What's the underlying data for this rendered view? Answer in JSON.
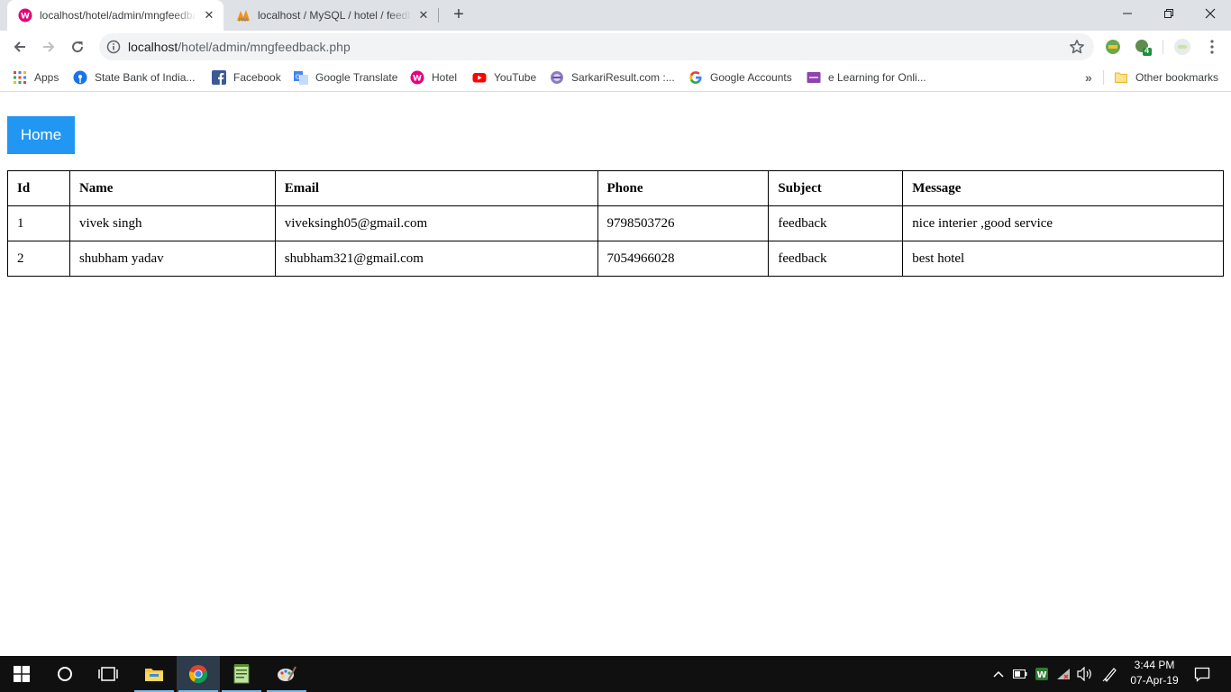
{
  "browser": {
    "tabs": [
      {
        "title": "localhost/hotel/admin/mngfeedback.php",
        "active": true
      },
      {
        "title": "localhost / MySQL / hotel / feedback",
        "active": false
      }
    ],
    "url_host": "localhost",
    "url_path": "/hotel/admin/mngfeedback.php",
    "extension_badge": "4",
    "bookmarks": [
      {
        "label": "Apps",
        "icon": "apps-grid-icon"
      },
      {
        "label": "State Bank of India...",
        "icon": "sbi-icon"
      },
      {
        "label": "Facebook",
        "icon": "facebook-icon"
      },
      {
        "label": "Google Translate",
        "icon": "google-translate-icon"
      },
      {
        "label": "Hotel",
        "icon": "wamp-icon"
      },
      {
        "label": "YouTube",
        "icon": "youtube-icon"
      },
      {
        "label": "SarkariResult.com :...",
        "icon": "sarkari-result-icon"
      },
      {
        "label": "Google Accounts",
        "icon": "google-icon"
      },
      {
        "label": "e Learning for Onli...",
        "icon": "elearning-icon"
      }
    ],
    "other_bookmarks": "Other bookmarks",
    "overflow": "»"
  },
  "page": {
    "home_label": "Home",
    "columns": [
      "Id",
      "Name",
      "Email",
      "Phone",
      "Subject",
      "Message"
    ],
    "rows": [
      [
        "1",
        "vivek singh",
        "viveksingh05@gmail.com",
        "9798503726",
        "feedback",
        "nice interier ,good service"
      ],
      [
        "2",
        "shubham yadav",
        "shubham321@gmail.com",
        "7054966028",
        "feedback",
        "best hotel"
      ]
    ]
  },
  "taskbar": {
    "time": "3:44 PM",
    "date": "07-Apr-19"
  },
  "colors": {
    "home_button": "#2196F3",
    "tabstrip": "#dee1e6",
    "taskbar": "#101010"
  }
}
